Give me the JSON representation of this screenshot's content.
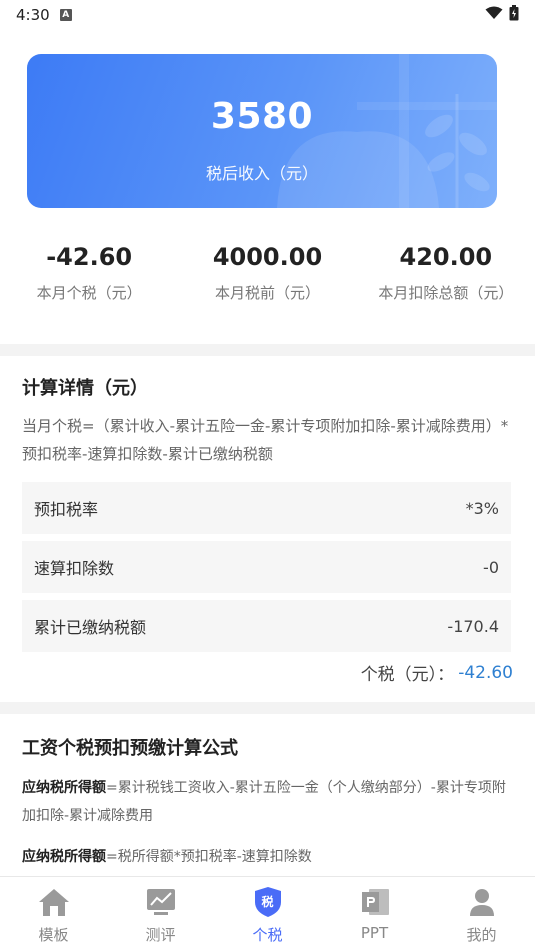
{
  "status_bar": {
    "time": "4:30",
    "notification_letter": "A"
  },
  "hero": {
    "value": "3580",
    "label": "税后收入（元）"
  },
  "stats": [
    {
      "value": "-42.60",
      "label": "本月个税（元）"
    },
    {
      "value": "4000.00",
      "label": "本月税前（元）"
    },
    {
      "value": "420.00",
      "label": "本月扣除总额（元）"
    }
  ],
  "details": {
    "title": "计算详情（元）",
    "formula": "当月个税=（累计收入-累计五险一金-累计专项附加扣除-累计减除费用）*预扣税率-速算扣除数-累计已缴纳税额",
    "rows": [
      {
        "label": "预扣税率",
        "value": "*3%"
      },
      {
        "label": "速算扣除数",
        "value": "-0"
      },
      {
        "label": "累计已缴纳税额",
        "value": "-170.4"
      }
    ],
    "total_label": "个税（元）：",
    "total_value": "-42.60"
  },
  "formulas": {
    "title": "工资个税预扣预缴计算公式",
    "items": [
      {
        "term": "应纳税所得额",
        "text": "=累计税钱工资收入-累计五险一金（个人缴纳部分）-累计专项附加扣除-累计减除费用"
      },
      {
        "term": "应纳税所得额",
        "text": "=税所得额*预扣税率-速算扣除数"
      }
    ]
  },
  "nav": {
    "items": [
      {
        "label": "模板",
        "icon": "home-icon"
      },
      {
        "label": "测评",
        "icon": "chart-icon"
      },
      {
        "label": "个税",
        "icon": "tax-shield-icon",
        "badge": "税"
      },
      {
        "label": "PPT",
        "icon": "ppt-icon"
      },
      {
        "label": "我的",
        "icon": "user-icon"
      }
    ],
    "active_index": 2
  },
  "colors": {
    "accent": "#4a6cf7",
    "hero_start": "#3d7bf5",
    "hero_end": "#7fb0fb",
    "total_value": "#2f80d1"
  }
}
